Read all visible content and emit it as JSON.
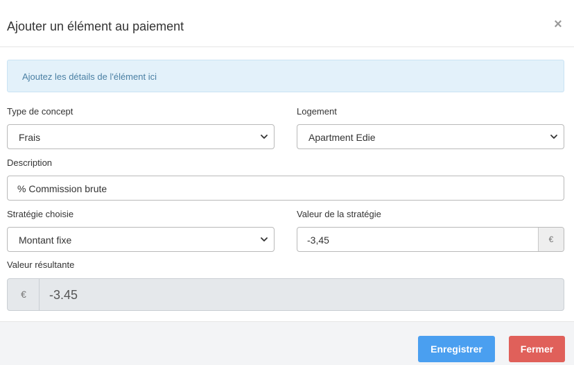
{
  "modal": {
    "title": "Ajouter un élément au paiement",
    "close_symbol": "×"
  },
  "info": {
    "text": "Ajoutez les détails de l'élément ici"
  },
  "form": {
    "concept_type": {
      "label": "Type de concept",
      "value": "Frais"
    },
    "housing": {
      "label": "Logement",
      "value": "Apartment Edie"
    },
    "description": {
      "label": "Description",
      "value": "% Commission brute"
    },
    "strategy": {
      "label": "Stratégie choisie",
      "value": "Montant fixe"
    },
    "strategy_value": {
      "label": "Valeur de la stratégie",
      "value": "-3,45",
      "addon": "€"
    },
    "result": {
      "label": "Valeur résultante",
      "addon": "€",
      "value": "-3.45"
    }
  },
  "footer": {
    "save_label": "Enregistrer",
    "close_label": "Fermer"
  },
  "icons": {
    "close": "close-icon",
    "chevron": "chevron-down-icon",
    "currency": "euro-icon"
  },
  "colors": {
    "info_bg": "#e3f1fa",
    "info_text": "#4a7fa3",
    "save_button": "#4a9ff0",
    "close_button": "#e0605a",
    "footer_bg": "#f3f4f6",
    "readonly_bg": "#e5e8eb"
  }
}
